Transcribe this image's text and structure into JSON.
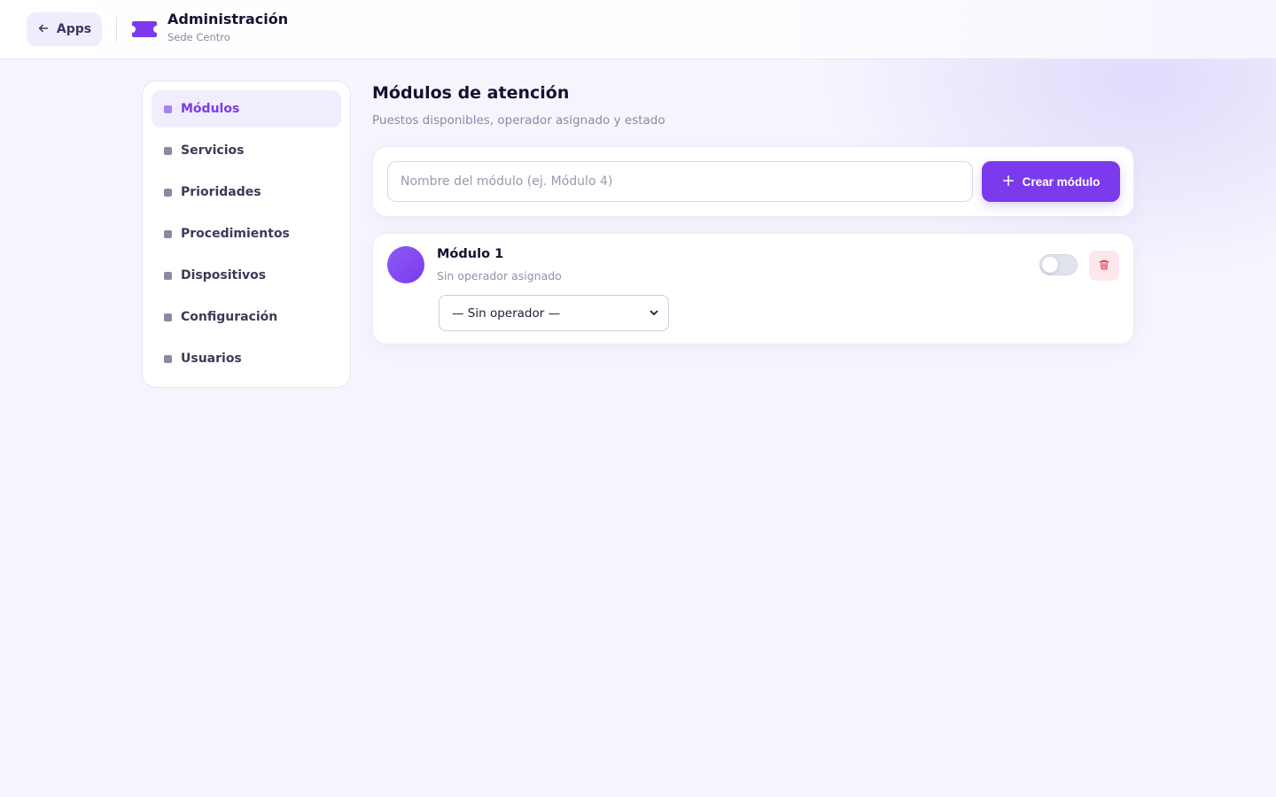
{
  "header": {
    "back_label": "Apps",
    "title": "Administración",
    "subtitle": "Sede Centro",
    "brand_color": "#7b3aec"
  },
  "sidebar": {
    "items": [
      {
        "label": "Módulos",
        "active": true
      },
      {
        "label": "Servicios",
        "active": false
      },
      {
        "label": "Prioridades",
        "active": false
      },
      {
        "label": "Procedimientos",
        "active": false
      },
      {
        "label": "Dispositivos",
        "active": false
      },
      {
        "label": "Configuración",
        "active": false
      },
      {
        "label": "Usuarios",
        "active": false
      }
    ]
  },
  "main": {
    "title": "Módulos de atención",
    "subtitle": "Puestos disponibles, operador asignado y estado",
    "create": {
      "placeholder": "Nombre del módulo (ej. Módulo 4)",
      "value": "",
      "button_label": "Crear módulo"
    },
    "modules": [
      {
        "name": "Módulo 1",
        "status": "Sin operador asignado",
        "operator_selected": "— Sin operador —",
        "enabled": false
      }
    ]
  },
  "icons": {
    "back": "arrow-left-icon",
    "brand": "ticket-icon",
    "add": "plus-icon",
    "delete": "trash-icon",
    "dropdown": "chevron-down-icon"
  },
  "colors": {
    "accent": "#7b3aec",
    "danger": "#e53e5a",
    "background": "#f6f5fd"
  }
}
